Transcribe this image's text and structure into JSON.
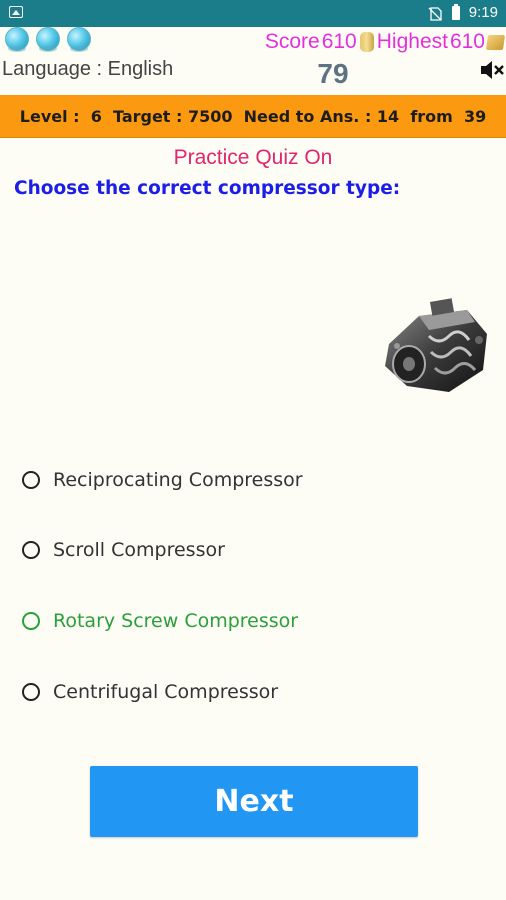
{
  "status_bar": {
    "time": "9:19",
    "icons": [
      "notification-image-icon",
      "no-sim-icon",
      "battery-icon"
    ]
  },
  "header": {
    "hint_icons": [
      "hint-orb-icon",
      "hint-orb-icon",
      "hint-orb-icon"
    ],
    "score_label": "Score",
    "score_value": "610",
    "highest_label": "Highest",
    "highest_value": "610",
    "language_text": "Language : English",
    "question_counter": "79",
    "mute_icon": "speaker-muted-icon"
  },
  "level_bar": {
    "text": "Level :  6  Target : 7500  Need to Ans. : 14  from  39",
    "color": "#fb9a10"
  },
  "quiz": {
    "title": "Practice Quiz On",
    "question": "Choose the correct compressor type:",
    "image": "rotary-screw-compressor-image",
    "options": [
      {
        "label": "Reciprocating Compressor",
        "state": "normal"
      },
      {
        "label": "Scroll Compressor",
        "state": "normal"
      },
      {
        "label": "Rotary Screw Compressor",
        "state": "correct"
      },
      {
        "label": "Centrifugal Compressor",
        "state": "normal"
      }
    ]
  },
  "next_button": {
    "label": "Next",
    "color": "#2196f3"
  },
  "colors": {
    "status_bar": "#1c7d8a",
    "score_text": "#e62fdc",
    "title_text": "#e0266e",
    "question_text": "#1c1ee8",
    "correct_option": "#2aa03a"
  }
}
